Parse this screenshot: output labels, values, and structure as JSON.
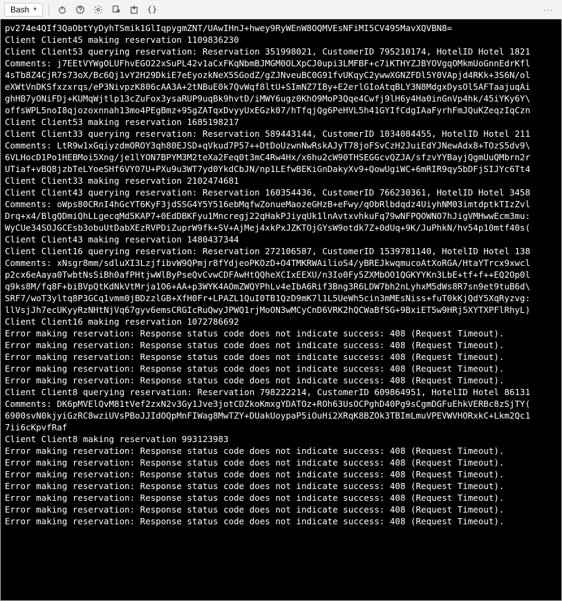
{
  "toolbar": {
    "shell_label": "Bash",
    "icons": {
      "power": "power-icon",
      "help": "help-icon",
      "gear": "gear-icon",
      "export": "export-icon",
      "import": "import-icon",
      "braces": "braces-icon"
    },
    "overflow": "···"
  },
  "terminal_lines": [
    "pv274e4QIf3QaObtYyDyhTSmik1GlIqpygmZNT/UAwIHnJ+hwey9RyWEnW8OQMVEsNFiMI5CV495MavXQVBN8=",
    "Client Client45 making reservation 1109836230",
    "Client Client53 querying reservation: Reservation 351998021, CustomerID 795210174, HotelID Hotel 1821",
    "Comments: j7EEtVYWgOLUFhvEGO22xSuPL42v1aCxFKqNbmBJMGM0OLXpCJ0upi3LMFBF+c7iKTHYZJBYOVgqOMkmUoGnnEdrKfl",
    "4sTb8Z4CjR7s73oX/Bc6Qj1vY2H29DkiE7eEyozkNeX5SGodZ/gZJNveuBC0G91fvUKqyC2ywwXGNZFDl5Y0VApjd4RKk+3S6N/ol",
    "eXWtVnDKSfxzxrqs/eP3NivpzK806cAA3A+2tNBuE0k7QvWqf8ltU+SImNZ7IBy+E2erlGIoAtqBLY3N8MdgxDysOl5AFTaajuqAi",
    "ghHB7yONiFDj+KUMqWjtlp13cZuFox3ysaRUP9uqBk9hvtD/iMWY6ugz0KhO9MoP3Qqe4Cwfj9lH6y4Ha0inGnVp4hk/45iYKy6Y\\",
    "offsWPL5noI8qjozoxnnah13mo4PEgBmz+95gZATqxDvyyUxEGzk07/hTfqjQg6PeHVL5h41GYIfCdgIAaFyrhFmJQuKZeqzIqCzn",
    "Client Client53 making reservation 1685198217",
    "Client Client33 querying reservation: Reservation 589443144, CustomerID 1034084455, HotelID Hotel 211",
    "Comments: LtR9w1xGqiyzdmOROY3qh80EJSD+qVkud7P57++DtDoUzwnNwRskAJyT78joFSvCzH2JuiEdYJNewAdx8+TOzS5dv9\\",
    "6VLHocD1Po1HEBMoi5Xng/je1lYON7BPYM3M2teXa2Feq0t3mC4Rw4Hx/x6hu2cW90THSEGGcvQZJA/sfzvYYBayjQgmUuQMbrn2r",
    "UTiaf+vBQ8jzbTeLYoeSHf6VYO7U+PXu9u3WT7yd0YkdCbJN/np1LEfwBEKiGnDakyXv9+QowUgiWC+6mRIR9qy5bDFjSIJYc6Tt4",
    "Client Client33 making reservation 2102474681",
    "Client Client43 querying reservation: Reservation 160354436, CustomerID 766230361, HotelID Hotel 3458",
    "Comments: oWps80CRnI4hGcYT6KyF3jdSSG4Y5Y516ebMqfwZonueMaozeGHzB+eFwy/qObRlbdqdz4UiyhNM03imtdptkTIzZvl",
    "Drq+x4/BlgQDmiQhLLgecqMd5KAP7+0EdDBKFyu1Mncregj22qHakPJiyqUk1lnAvtxvhkuFq79wNFPQOWNO7hJigVMHwwEcm3mu:",
    "WyCUe34SOJGCEsb3obuUtDabXEzRVPDiZuprW9fk+SV+AjMej4xkPxJZKTOjGYsW9otdk7Z+0dUq+9K/JuPhkN/hv54p10mtf40s(",
    "Client Client43 making reservation 1480437344",
    "Client Client16 querying reservation: Reservation 272106587, CustomerID 1539781140, HotelID Hotel 138",
    "Comments: xNsgr8mm/sdluXI3LzjfibvW9QPmjr8fYdjeoPKOzD+O4TMKRWAilioS4/yBREJkwqmucoAtXoRGA/HtaYTrcx9xwcl",
    "p2cx6eAaya0TwbtNsSiBh0afPHtjwWlByPseQvCvwCDFAwHtQQheXCIxEEXU/n3Io0Fy5ZXMbOO1QGKYYKn3LbE+tf+f++EQ2Op0l",
    "q9ks8M/fq8F+biBVpQtKdNkVtMrja1O6+AA+p3WYK4AOmZWQYPhLv4eIbA6Rif3Bng3R6LDW7bh2nLyhxM5dWs8R7sn9et9tuB6d\\",
    "SRF7/woT3yltq8P3GCq1vmm0jBDzzlGB+XfH0Fr+LPAZL1QuI0TB1QzD9mK7l1L5UeWh5cin3mMEsNiss+fuT0kKjQdY5XqRyzvg:",
    "llVsjJh7ecUKyyRzNHtNjVq67gyv6emsCRGIcRuQwyJPWQ1rjMoON3wMCyCnD6VRK2hQCWaBfSG+9BxiET5w9HRj5XYTXPFlRhyL)",
    "Client Client16 making reservation 1072786692",
    "Error making reservation: Response status code does not indicate success: 408 (Request Timeout).",
    "Error making reservation: Response status code does not indicate success: 408 (Request Timeout).",
    "Error making reservation: Response status code does not indicate success: 408 (Request Timeout).",
    "Error making reservation: Response status code does not indicate success: 408 (Request Timeout).",
    "Error making reservation: Response status code does not indicate success: 408 (Request Timeout).",
    "Client Client8 querying reservation: Reservation 798222214, CustomerID 609864951, HotelID Hotel 86131",
    "Comments: DK6pMVElQvM81tVef2zxN2v3Gy1Jve3jotCDZkoKmxgYDATOz+ROh63UsOCPghD40Pg9sCgmDGFuEhkVERBc8zSjTY(",
    "6900svN0kjyiGzRC8wziUVsPBoJJIdOQpMnFIWag8MwTZY+DUakUoypaP5iOuHi2XRqK8BZOk3TBImLmuVPEVWVHORxkC+Lkm2Qc1",
    "7ii6cKpvfRaf",
    "Client Client8 making reservation 993123983",
    "Error making reservation: Response status code does not indicate success: 408 (Request Timeout).",
    "Error making reservation: Response status code does not indicate success: 408 (Request Timeout).",
    "Error making reservation: Response status code does not indicate success: 408 (Request Timeout).",
    "Error making reservation: Response status code does not indicate success: 408 (Request Timeout).",
    "Error making reservation: Response status code does not indicate success: 408 (Request Timeout).",
    "Error making reservation: Response status code does not indicate success: 408 (Request Timeout).",
    "Error making reservation: Response status code does not indicate success: 408 (Request Timeout)."
  ]
}
